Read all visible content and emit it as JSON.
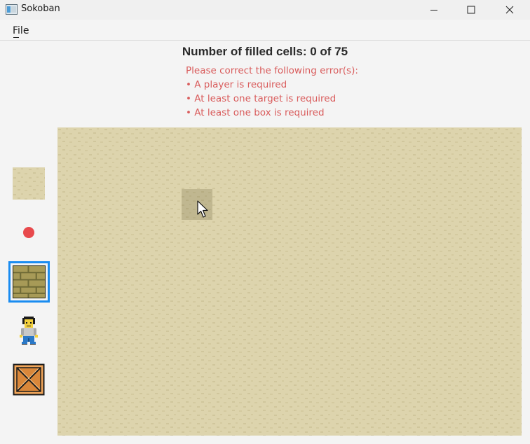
{
  "window": {
    "title": "Sokoban",
    "icons": {
      "app": "app-icon",
      "minimize": "minimize-icon",
      "maximize": "maximize-icon",
      "close": "close-icon"
    }
  },
  "menu": {
    "file_label": "File"
  },
  "status": {
    "filled_cells_text": "Number of filled cells: 0 of 75"
  },
  "errors": {
    "intro": "Please correct the following error(s):",
    "items": [
      "• A player is required",
      "• At least one target is required",
      "• At least one box is required"
    ],
    "color": "#d95c5c"
  },
  "palette": {
    "items": [
      {
        "icon": "floor-tile-icon",
        "selected": false
      },
      {
        "icon": "target-icon",
        "selected": false
      },
      {
        "icon": "wall-tile-icon",
        "selected": true
      },
      {
        "icon": "player-icon",
        "selected": false
      },
      {
        "icon": "box-icon",
        "selected": false
      }
    ],
    "selection_color": "#1a8cf0"
  },
  "board": {
    "texture": "sand",
    "background": "#ddd4ad",
    "cursor": "pointer-cursor-icon"
  }
}
